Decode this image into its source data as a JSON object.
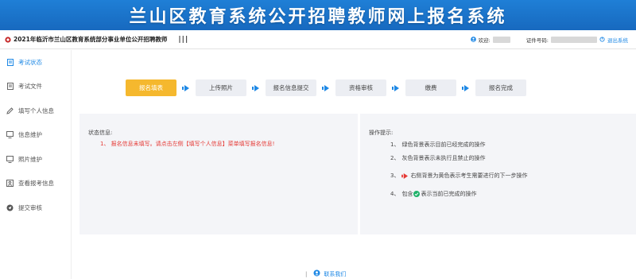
{
  "banner": {
    "title": "兰山区教育系统公开招聘教师网上报名系统"
  },
  "topbar": {
    "exam_name": "2021年临沂市兰山区教育系统部分事业单位公开招聘教师",
    "menu_toggle": "|||",
    "welcome_label": "欢迎:",
    "id_label": "证件号码:",
    "logout_label": "退出系统"
  },
  "sidebar": {
    "items": [
      {
        "label": "考试状态",
        "icon": "file-icon",
        "active": true
      },
      {
        "label": "考试文件",
        "icon": "file-icon"
      },
      {
        "label": "填写个人信息",
        "icon": "pencil-icon"
      },
      {
        "label": "信息维护",
        "icon": "monitor-icon"
      },
      {
        "label": "照片维护",
        "icon": "monitor-icon"
      },
      {
        "label": "查看报考信息",
        "icon": "profile-icon"
      },
      {
        "label": "提交审核",
        "icon": "send-icon"
      }
    ]
  },
  "steps": [
    {
      "label": "报名填表",
      "current": true
    },
    {
      "label": "上传照片"
    },
    {
      "label": "报名信息提交"
    },
    {
      "label": "资格审核"
    },
    {
      "label": "缴费"
    },
    {
      "label": "报名完成"
    }
  ],
  "status_panel": {
    "title": "状态信息:",
    "message": "1、 报名信息未填写。请点击左侧【填写个人信息】菜单填写报名信息!"
  },
  "tips_panel": {
    "title": "操作提示:",
    "tips": [
      {
        "num": "1、",
        "text": "绿色背景表示目前已经完成的操作"
      },
      {
        "num": "2、",
        "text": "灰色背景表示未执行且禁止的操作"
      },
      {
        "num": "3、",
        "text": "右侧背景为黄色表示考生需要进行的下一步操作"
      },
      {
        "num": "4、",
        "pre": "包含",
        "post": "表示当前已完成的操作"
      }
    ]
  },
  "footer": {
    "separator": "|",
    "contact_label": "联系我们"
  },
  "colors": {
    "banner": "#1769bf",
    "accent": "#1e88e5",
    "current_step": "#f5b82e",
    "error": "#e53935",
    "done": "#20b26b"
  }
}
